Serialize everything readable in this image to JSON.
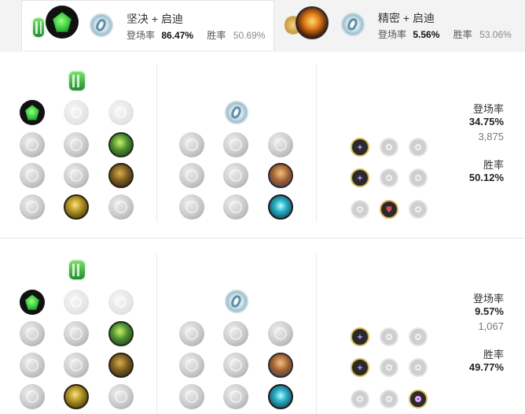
{
  "tabs": [
    {
      "name": "坚决 + 启迪",
      "pick_label": "登场率",
      "pick_value": "86.47%",
      "win_label": "胜率",
      "win_value": "50.69%",
      "primary_icon": "resolve-domination-emblem-icon",
      "secondary_icon": "inspiration-emblem-icon",
      "active": true
    },
    {
      "name": "精密 + 启迪",
      "pick_label": "登场率",
      "pick_value": "5.56%",
      "win_label": "胜率",
      "win_value": "53.06%",
      "primary_icon": "precision-emblem-icon",
      "secondary_icon": "inspiration-emblem-icon",
      "active": false
    }
  ],
  "builds": [
    {
      "pick_label": "登场率",
      "pick_value": "34.75%",
      "games": "3,875",
      "win_label": "胜率",
      "win_value": "50.12%"
    },
    {
      "pick_label": "登场率",
      "pick_value": "9.57%",
      "games": "1,067",
      "win_label": "胜率",
      "win_value": "49.77%"
    }
  ],
  "icons": {
    "primary_tree": "resolve-tree-icon",
    "secondary_tree": "inspiration-tree-icon",
    "keystone": "grasp-of-the-undying-icon",
    "adaptive_shard": "adaptive-force-shard-icon",
    "armor_shard": "armor-shard-icon",
    "mr_shard": "magic-resist-shard-icon",
    "health_shard": "health-shard-icon"
  },
  "colors": {
    "resolve_green": "#2ec43c",
    "shard_border_gold": "#d9b85a",
    "tab_bg": "#f3f3f3"
  }
}
